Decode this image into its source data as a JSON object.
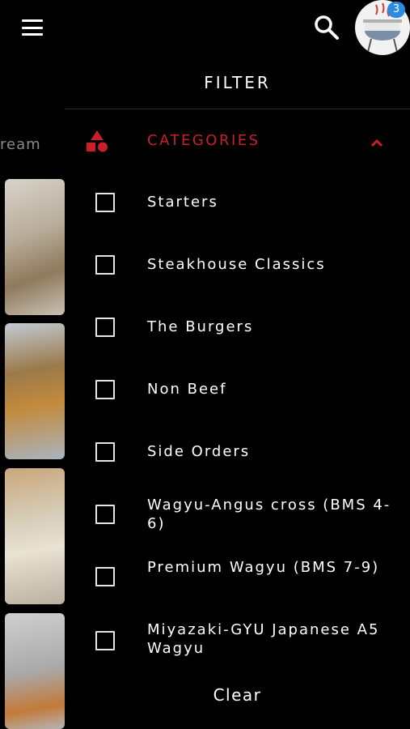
{
  "header": {
    "menu_icon": "hamburger-menu-icon",
    "search_icon": "search-icon",
    "cart_badge": "3"
  },
  "background": {
    "partial_text": "ream"
  },
  "filter": {
    "title": "FILTER",
    "categories_label": "CATEGORIES",
    "categories_icon": "shapes-icon",
    "accent_color": "#c8202a",
    "options": [
      {
        "label": "Starters",
        "checked": false
      },
      {
        "label": "Steakhouse Classics",
        "checked": false
      },
      {
        "label": "The Burgers",
        "checked": false
      },
      {
        "label": "Non Beef",
        "checked": false
      },
      {
        "label": "Side Orders",
        "checked": false
      },
      {
        "label": "Wagyu-Angus cross (BMS 4-6)",
        "checked": false
      },
      {
        "label": "Premium Wagyu (BMS 7-9)",
        "checked": false
      },
      {
        "label": "Miyazaki-GYU Japanese A5 Wagyu",
        "checked": false
      }
    ],
    "clear_label": "Clear"
  }
}
